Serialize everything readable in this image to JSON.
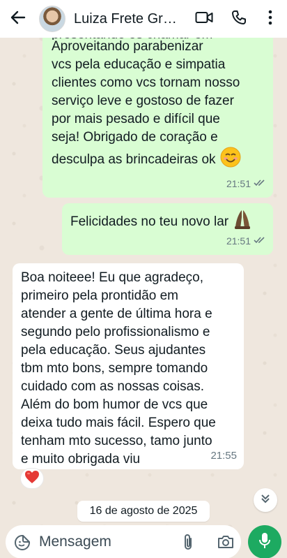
{
  "header": {
    "back_icon": "arrow-back-icon",
    "contact_name": "Luiza Frete Gr…",
    "video_icon": "video-call-icon",
    "call_icon": "phone-icon",
    "menu_icon": "more-vert-icon"
  },
  "messages": [
    {
      "direction": "outgoing",
      "text": "Aproveitando parabenizar\nvcs pela educação e simpatia\nclientes como vcs tornam nosso\nserviço leve e gostoso de fazer\npor mais pesado e difícil que\nseja! Obrigado de coração e\ndesculpa as brincadeiras ok",
      "emoji": "smiling-face-emoji",
      "time": "21:51",
      "status": "read"
    },
    {
      "direction": "outgoing",
      "text": "Felicidades no teu novo lar",
      "emoji": "folded-hands-emoji",
      "time": "21:51",
      "status": "read"
    },
    {
      "direction": "incoming",
      "text": "Boa noiteee! Eu que agradeço,\nprimeiro pela prontidão em\natender a gente de última hora e\nsegundo pelo profissionalismo e\npela educação. Seus ajudantes\ntbm mto bons, sempre tomando\ncuidado com as nossas coisas.\nAlém do bom humor de vcs que\ndeixa tudo mais fácil. Espero que\ntenham mto sucesso, tamo junto\ne muito obrigada viu",
      "time": "21:55",
      "reaction": "red-heart-emoji"
    }
  ],
  "date_chip": "16 de agosto de 2025",
  "composer": {
    "placeholder": "Mensagem",
    "sticker_icon": "sticker-icon",
    "attach_icon": "paperclip-icon",
    "camera_icon": "camera-icon",
    "mic_icon": "microphone-icon"
  },
  "colors": {
    "outgoing_bubble": "#d9fdd3",
    "incoming_bubble": "#ffffff",
    "accent_green": "#1daa61",
    "background": "#efe7de"
  }
}
